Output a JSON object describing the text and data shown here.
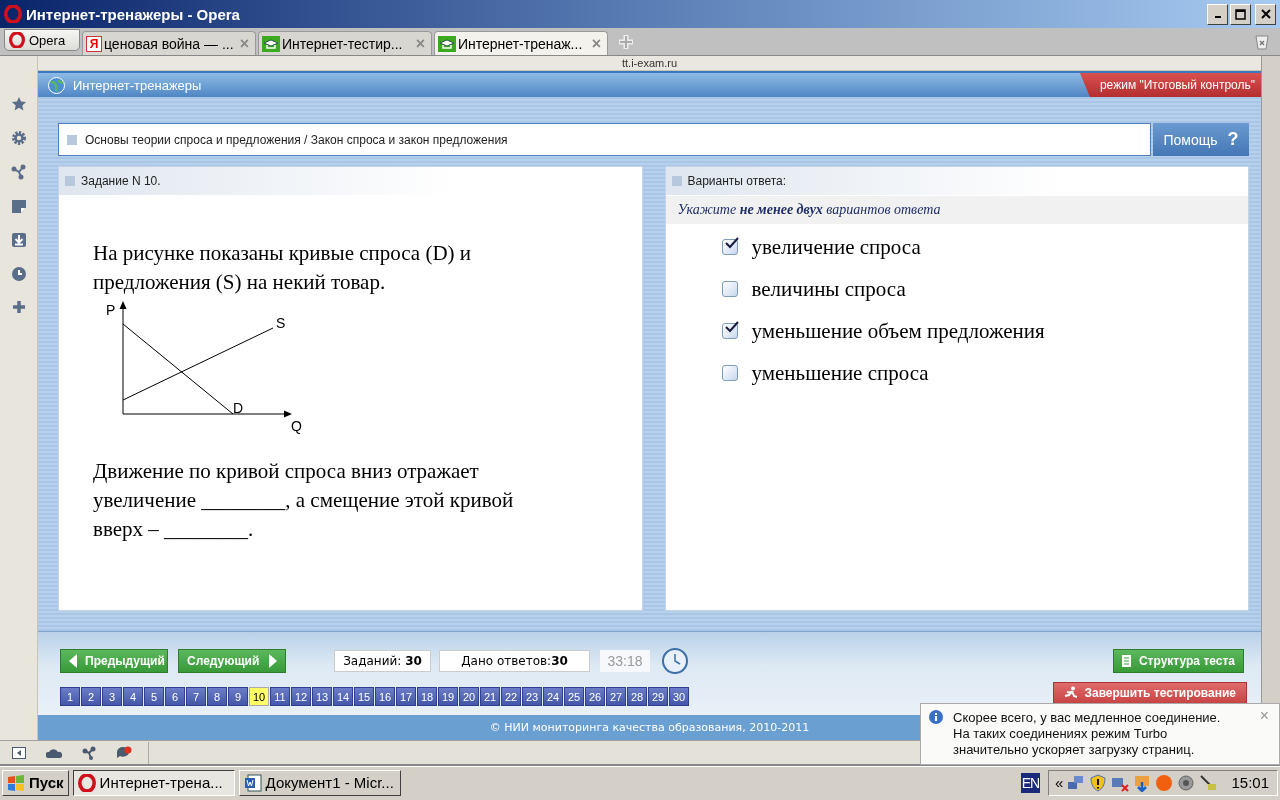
{
  "window": {
    "title": "Интернет-тренажеры - Opera"
  },
  "browser": {
    "menu_label": "Opera",
    "tabs": [
      {
        "label": "ценовая война — ...",
        "selected": false,
        "kind": "yandex",
        "icon_text": "Я",
        "close": "×"
      },
      {
        "label": "Интернет-тестир...",
        "selected": false,
        "kind": "site",
        "close": "×"
      },
      {
        "label": "Интернет-тренаж...",
        "selected": true,
        "kind": "site",
        "close": "×"
      }
    ],
    "address": "tt.i-exam.ru"
  },
  "page": {
    "header_title": "Интернет-тренажеры",
    "mode_badge": "режим \"Итоговый контроль\"",
    "breadcrumb": "Основы теории спроса и предложения / Закон спроса и закон предложения",
    "help_button": "Помощь",
    "help_icon": "?",
    "task": {
      "title": "Задание N 10.",
      "intro": "На рисунке показаны кривые спроса (D) и предложения (S) на некий товар.",
      "graph_labels": {
        "y_axis": "P",
        "supply": "S",
        "demand": "D",
        "x_axis": "Q"
      },
      "question": "Движение по кривой спроса вниз отражает увеличение ________, а смещение этой кривой вверх  –  ________."
    },
    "answers": {
      "title": "Варианты ответа:",
      "instruction": "Укажите **не менее двух** вариантов ответа",
      "options": [
        {
          "label": "увеличение спроса",
          "checked": true
        },
        {
          "label": "величины спроса",
          "checked": false
        },
        {
          "label": "уменьшение объем предложения",
          "checked": true
        },
        {
          "label": "уменьшение спроса",
          "checked": false
        }
      ]
    },
    "navigation": {
      "prev": "Предыдущий",
      "next": "Следующий",
      "tasks_label": "Заданий:",
      "tasks_count": "30",
      "answered_label": "Дано ответов:",
      "answered_count": "30",
      "timer": "33:18",
      "structure_button": "Структура теста",
      "finish_button": "Завершить тестирование",
      "pages": [
        {
          "label": "1",
          "selected": false
        },
        {
          "label": "2",
          "selected": false
        },
        {
          "label": "3",
          "selected": false
        },
        {
          "label": "4",
          "selected": false
        },
        {
          "label": "5",
          "selected": false
        },
        {
          "label": "6",
          "selected": false
        },
        {
          "label": "7",
          "selected": false
        },
        {
          "label": "8",
          "selected": false
        },
        {
          "label": "9",
          "selected": false
        },
        {
          "label": "10",
          "selected": true
        },
        {
          "label": "11",
          "selected": false
        },
        {
          "label": "12",
          "selected": false
        },
        {
          "label": "13",
          "selected": false
        },
        {
          "label": "14",
          "selected": false
        },
        {
          "label": "15",
          "selected": false
        },
        {
          "label": "16",
          "selected": false
        },
        {
          "label": "17",
          "selected": false
        },
        {
          "label": "18",
          "selected": false
        },
        {
          "label": "19",
          "selected": false
        },
        {
          "label": "20",
          "selected": false
        },
        {
          "label": "21",
          "selected": false
        },
        {
          "label": "22",
          "selected": false
        },
        {
          "label": "23",
          "selected": false
        },
        {
          "label": "24",
          "selected": false
        },
        {
          "label": "25",
          "selected": false
        },
        {
          "label": "26",
          "selected": false
        },
        {
          "label": "27",
          "selected": false
        },
        {
          "label": "28",
          "selected": false
        },
        {
          "label": "29",
          "selected": false
        },
        {
          "label": "30",
          "selected": false
        }
      ]
    },
    "footer": "© НИИ мониторинга качества образования, 2010-2011"
  },
  "notification": {
    "lines": [
      "Скорее всего, у вас медленное соединение.",
      "На таких соединениях режим Turbo",
      "значительно ускоряет загрузку страниц."
    ],
    "close": "×"
  },
  "taskbar": {
    "start": "Пуск",
    "tasks": [
      {
        "label": "Интернет-трена...",
        "selected": true,
        "kind": "opera"
      },
      {
        "label": "Документ1 - Micr...",
        "selected": false,
        "kind": "word"
      }
    ],
    "language": "EN",
    "tray_toggle": "«",
    "clock": "15:01"
  }
}
